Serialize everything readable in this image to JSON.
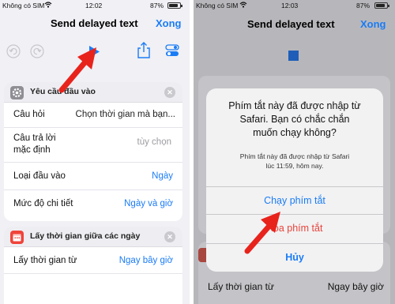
{
  "left": {
    "status": {
      "carrier": "Không có SIM",
      "time": "12:02",
      "battery": "87%"
    },
    "nav": {
      "title": "Send delayed text",
      "done": "Xong"
    },
    "toolbar": {
      "undo_icon": "undo-icon",
      "redo_icon": "redo-icon",
      "play_icon": "play-icon",
      "share_icon": "share-icon",
      "settings_icon": "toggle-settings-icon"
    },
    "input_card": {
      "title": "Yêu cầu đầu vào",
      "icon": "gear-icon",
      "rows": [
        {
          "label": "Câu hỏi",
          "value": "Chọn thời gian mà bạn..."
        },
        {
          "label": "Câu trả lời mặc định",
          "label_lines": [
            "Câu trả lời",
            "mặc định"
          ],
          "value": "tùy chọn"
        },
        {
          "label": "Loại đầu vào",
          "value": "Ngày"
        },
        {
          "label": "Mức độ chi tiết",
          "value": "Ngày và giờ"
        }
      ]
    },
    "time_card": {
      "title": "Lấy thời gian giữa các ngày",
      "icon": "calendar-icon",
      "rows": [
        {
          "label": "Lấy thời gian từ",
          "value": "Ngay bây giờ"
        }
      ]
    }
  },
  "right": {
    "status": {
      "carrier": "Không có SIM",
      "time": "12:03",
      "battery": "87%"
    },
    "nav": {
      "title": "Send delayed text",
      "done": "Xong"
    },
    "stop_icon": "stop-icon",
    "dialog": {
      "title": "Phím tắt này đã được nhập từ Safari. Bạn có chắc chắn muốn chạy không?",
      "title_lines": [
        "Phím tắt này đã được nhập từ",
        "Safari. Bạn có chắc chắn",
        "muốn chạy không?"
      ],
      "message": "Phím tắt này đã được nhập từ Safari lúc 11:59, hôm nay.",
      "message_lines": [
        "Phím tắt này đã được nhập từ Safari",
        "lúc 11:59, hôm nay."
      ],
      "run_button": "Chạy phím tắt",
      "delete_button": "Xóa phím tắt",
      "cancel_button": "Hủy"
    },
    "bottom_row": {
      "label": "Lấy thời gian từ",
      "value": "Ngay bây giờ"
    }
  },
  "colors": {
    "accent": "#1a7cf5",
    "destructive": "#e8433a",
    "arrow": "#e8231c"
  }
}
